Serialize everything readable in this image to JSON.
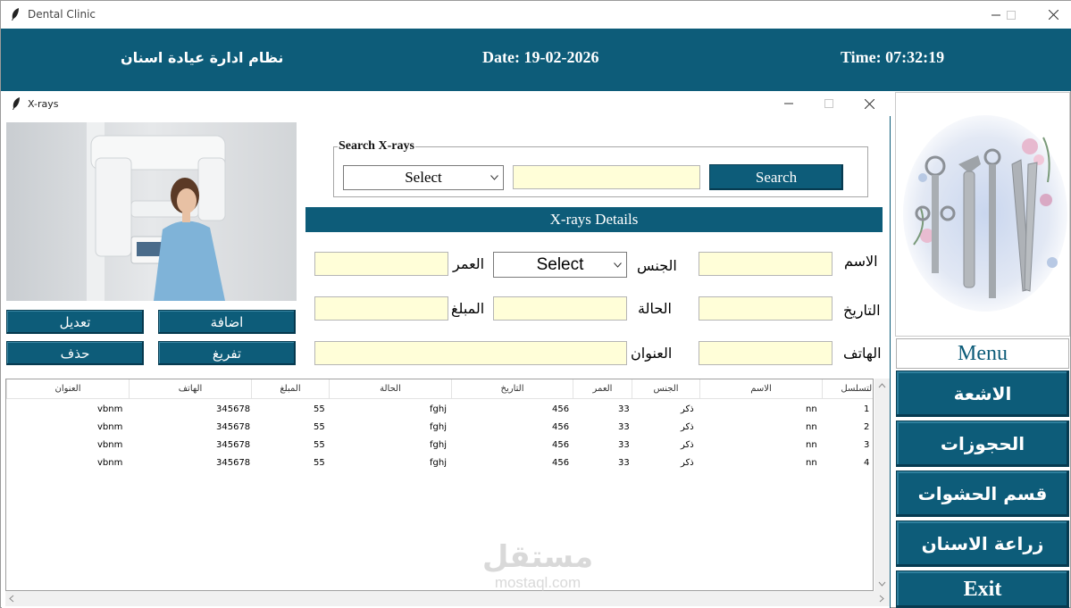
{
  "window": {
    "title": "Dental Clinic"
  },
  "header": {
    "app_title": "نظام ادارة عيادة اسنان",
    "date": "Date: 19-02-2026",
    "time": "Time: 07:32:19"
  },
  "child_window": {
    "title": "X-rays"
  },
  "actions": {
    "edit": "تعديل",
    "add": "اضافة",
    "delete": "حذف",
    "clear": "تفريغ"
  },
  "search": {
    "legend": "Search X-rays",
    "field_selected": "Select",
    "query_value": "",
    "button": "Search"
  },
  "details": {
    "section_title": "X-rays Details",
    "labels": {
      "name": "الاسم",
      "gender": "الجنس",
      "age": "العمر",
      "date": "التاريخ",
      "status": "الحالة",
      "amount": "المبلغ",
      "phone": "الهاتف",
      "address": "العنوان"
    },
    "gender_selected": "Select",
    "values": {
      "name": "",
      "age": "",
      "date": "",
      "status": "",
      "amount": "",
      "phone": "",
      "address": ""
    }
  },
  "table": {
    "columns": [
      "التسلسل",
      "الاسم",
      "الجنس",
      "العمر",
      "التاريخ",
      "الحالة",
      "المبلغ",
      "الهاتف",
      "العنوان"
    ],
    "rows": [
      {
        "id": "1",
        "name": "nn",
        "gender": "ذكر",
        "age": "33",
        "date": "456",
        "status": "fghj",
        "amount": "55",
        "phone": "345678",
        "address": "vbnm"
      },
      {
        "id": "2",
        "name": "nn",
        "gender": "ذكر",
        "age": "33",
        "date": "456",
        "status": "fghj",
        "amount": "55",
        "phone": "345678",
        "address": "vbnm"
      },
      {
        "id": "3",
        "name": "nn",
        "gender": "ذكر",
        "age": "33",
        "date": "456",
        "status": "fghj",
        "amount": "55",
        "phone": "345678",
        "address": "vbnm"
      },
      {
        "id": "4",
        "name": "nn",
        "gender": "ذكر",
        "age": "33",
        "date": "456",
        "status": "fghj",
        "amount": "55",
        "phone": "345678",
        "address": "vbnm"
      }
    ]
  },
  "watermark": {
    "arabic": "مستقل",
    "latin": "mostaql.com"
  },
  "menu": {
    "title": "Menu",
    "items": [
      "الاشعة",
      "الحجوزات",
      "قسم الحشوات",
      "زراعة الاسنان",
      "Exit"
    ]
  },
  "colors": {
    "primary": "#0d5c79",
    "entry_bg": "#fffed8"
  }
}
